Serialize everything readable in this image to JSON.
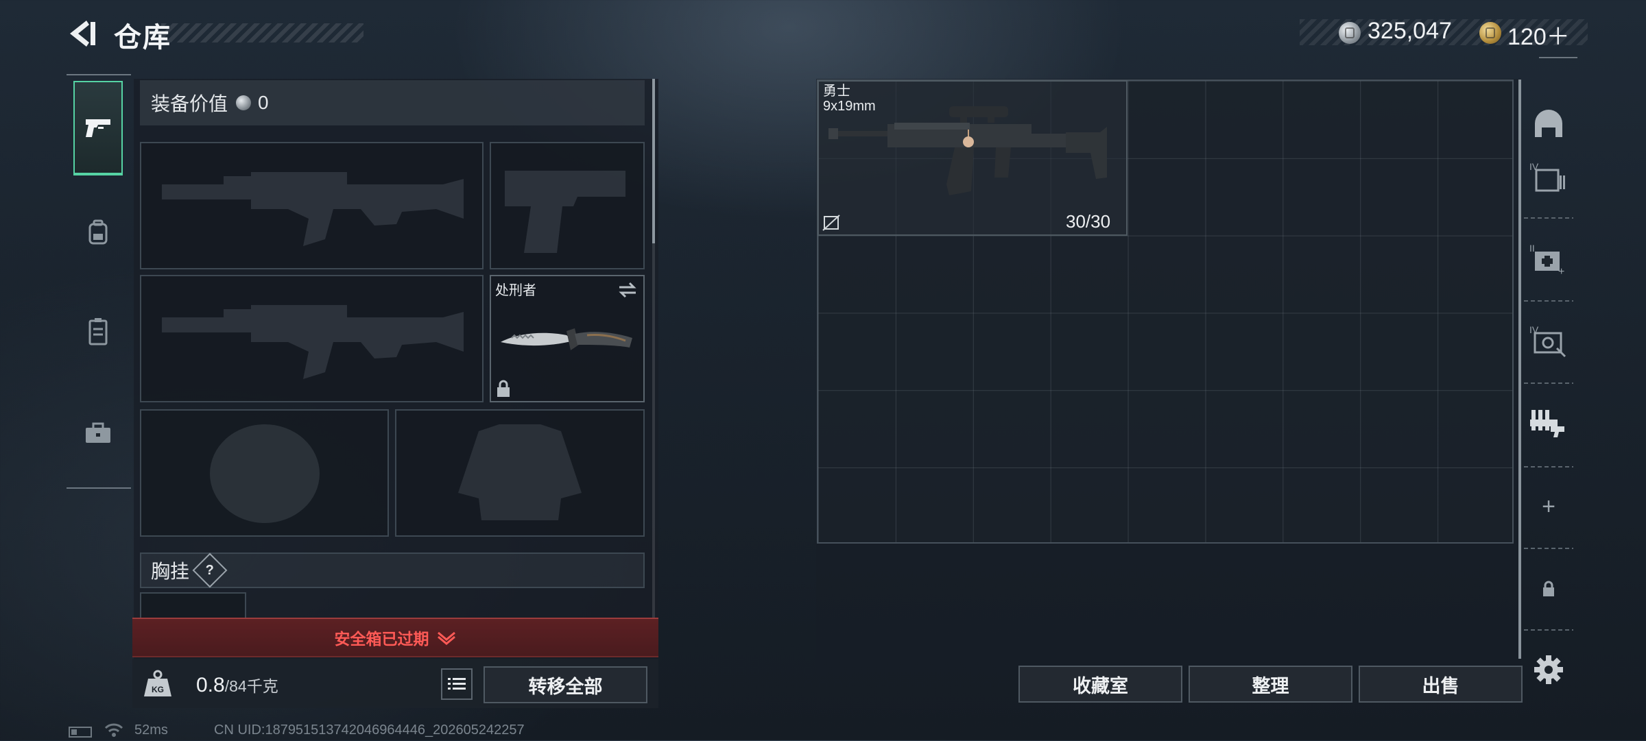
{
  "header": {
    "title": "仓库",
    "silver_amount": "325,047",
    "gold_amount": "120＋"
  },
  "equipment": {
    "value_label": "装备价值",
    "value_amount": "0",
    "knife_name": "处刑者",
    "chest_rig_label": "胸挂",
    "chest_rig_help": "?",
    "safebox_status": "安全箱已过期",
    "weight_current": "0.8",
    "weight_capacity": "/84千克",
    "transfer_all_label": "转移全部"
  },
  "stash": {
    "item": {
      "name": "勇士",
      "caliber": "9x19mm",
      "ammo_count": "30/30"
    },
    "buttons": {
      "collection": "收藏室",
      "organize": "整理",
      "sell": "出售"
    }
  },
  "status_bar": {
    "ping": "52ms",
    "uid": "CN UID:187951513742046964446_202605242257"
  },
  "colors": {
    "accent_green": "#56d3a4",
    "warning_red": "#ff5a56"
  },
  "icons": {
    "back": "back-arrow-icon",
    "tabs": [
      "pistol-icon",
      "backpack-icon",
      "vest-icon",
      "toolbox-icon"
    ],
    "rail": [
      "helmet-icon",
      "ammo-box-icon",
      "medkit-icon",
      "gear-case-icon",
      "weapon-rack-icon",
      "plus-icon",
      "lock-icon"
    ],
    "settings": "gear-icon"
  }
}
